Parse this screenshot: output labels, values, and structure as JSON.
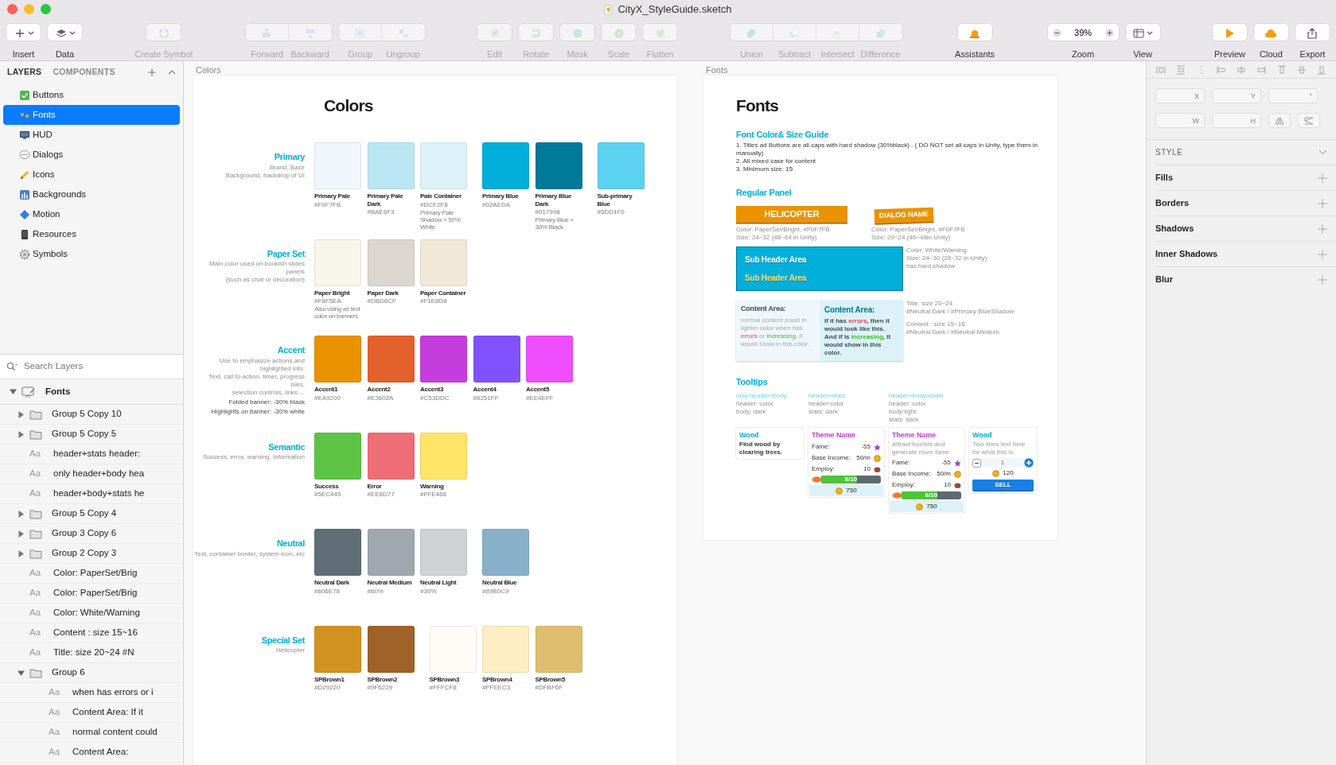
{
  "window": {
    "title": "CityX_StyleGuide.sketch"
  },
  "toolbar": {
    "sections": [
      [
        [
          {
            "label": "Insert",
            "kind": "dropdown",
            "disabled": false
          }
        ],
        [
          {
            "label": "Data",
            "kind": "dropdown",
            "disabled": false
          }
        ]
      ],
      [
        [
          {
            "label": "Create Symbol",
            "kind": "plain",
            "disabled": true
          }
        ]
      ],
      [
        [
          {
            "label": "Forward",
            "kind": "plain",
            "disabled": true
          },
          {
            "label": "Backward",
            "kind": "plain",
            "disabled": true
          }
        ],
        [
          {
            "label": "Group",
            "kind": "plain",
            "disabled": true
          },
          {
            "label": "Ungroup",
            "kind": "plain",
            "disabled": true
          }
        ]
      ],
      [
        [
          {
            "label": "Edit",
            "kind": "plain",
            "disabled": true
          }
        ],
        [
          {
            "label": "Rotate",
            "kind": "plain",
            "disabled": true
          }
        ],
        [
          {
            "label": "Mask",
            "kind": "plain",
            "disabled": true
          }
        ],
        [
          {
            "label": "Scale",
            "kind": "plain",
            "disabled": true
          }
        ],
        [
          {
            "label": "Flatten",
            "kind": "plain",
            "disabled": true
          }
        ]
      ],
      [
        [
          {
            "label": "Union",
            "kind": "plain",
            "disabled": true
          },
          {
            "label": "Subtract",
            "kind": "plain",
            "disabled": true
          },
          {
            "label": "Intersect",
            "kind": "plain",
            "disabled": true
          },
          {
            "label": "Difference",
            "kind": "plain",
            "disabled": true
          }
        ]
      ],
      [
        [
          {
            "label": "Assistants",
            "kind": "plain",
            "disabled": false
          }
        ]
      ],
      [
        [
          {
            "label": "Zoom",
            "kind": "zoom",
            "value": "39%",
            "disabled": false
          }
        ],
        [
          {
            "label": "View",
            "kind": "dropdown",
            "disabled": false
          }
        ]
      ],
      [
        [
          {
            "label": "Preview",
            "kind": "plain",
            "disabled": false
          }
        ],
        [
          {
            "label": "Cloud",
            "kind": "plain",
            "disabled": false
          }
        ],
        [
          {
            "label": "Export",
            "kind": "plain",
            "disabled": false
          }
        ]
      ]
    ]
  },
  "sidebar": {
    "tabs": [
      {
        "label": "LAYERS",
        "selected": true
      },
      {
        "label": "COMPONENTS",
        "selected": false
      }
    ],
    "pages": [
      {
        "label": "Buttons",
        "selected": false
      },
      {
        "label": "Fonts",
        "selected": true
      },
      {
        "label": "HUD",
        "selected": false
      },
      {
        "label": "Dialogs",
        "selected": false
      },
      {
        "label": "Icons",
        "selected": false
      },
      {
        "label": "Backgrounds",
        "selected": false
      },
      {
        "label": "Motion",
        "selected": false
      },
      {
        "label": "Resources",
        "selected": false
      },
      {
        "label": "Symbols",
        "selected": false
      }
    ],
    "search": {
      "placeholder": "Search Layers"
    },
    "layers": [
      {
        "label": "Fonts",
        "kind": "artboard",
        "expanded": true,
        "children": [
          {
            "label": "Group 5 Copy 10",
            "kind": "group",
            "expanded": false
          },
          {
            "label": "Group 5 Copy 5",
            "kind": "group",
            "expanded": false
          },
          {
            "label": "header+stats header:",
            "kind": "text",
            "glyph": "Aa"
          },
          {
            "label": "only header+body hea",
            "kind": "text",
            "glyph": "Aa"
          },
          {
            "label": "header+body+stats he",
            "kind": "text",
            "glyph": "Aa"
          },
          {
            "label": "Group 5 Copy 4",
            "kind": "group",
            "expanded": false
          },
          {
            "label": "Group 3 Copy 6",
            "kind": "group",
            "expanded": false
          },
          {
            "label": "Group 2 Copy 3",
            "kind": "group",
            "expanded": false
          },
          {
            "label": "Color: PaperSet/Brig",
            "kind": "text",
            "glyph": "Aa"
          },
          {
            "label": "Color: PaperSet/Brig",
            "kind": "text",
            "glyph": "Aa"
          },
          {
            "label": "Color: White/Warning",
            "kind": "text",
            "glyph": "Aa"
          },
          {
            "label": "Content : size 15~16",
            "kind": "text",
            "glyph": "Aa"
          },
          {
            "label": "Title: size 20~24 #N",
            "kind": "text",
            "glyph": "Aa"
          },
          {
            "label": "Group 6",
            "kind": "group",
            "expanded": true,
            "children": [
              {
                "label": "when has errors or i",
                "kind": "text",
                "glyph": "Aa"
              },
              {
                "label": "Content Area: If it",
                "kind": "text",
                "glyph": "Aa"
              },
              {
                "label": "normal content could",
                "kind": "text",
                "glyph": "Aa"
              },
              {
                "label": "Content Area:",
                "kind": "text",
                "glyph": "Aa"
              }
            ]
          }
        ]
      }
    ]
  },
  "colors_board": {
    "label": "Colors",
    "title": "Colors",
    "sections": [
      {
        "title": "Primary",
        "lines": [
          "Brand, Base",
          "Background, backdrop of UI"
        ],
        "groups": [
          [
            {
              "name": "Primary Pale",
              "hex": "#F0F7FB",
              "color": "#f0f7fb"
            },
            {
              "name": "Primary Pale Dark",
              "hex": "#BAE6F3",
              "color": "#bae6f3"
            },
            {
              "name": "Pale Container",
              "hex": "#DCF2F8",
              "note": "Primary Pale Shadow + 50% White",
              "color": "#dcf2f8"
            }
          ],
          [
            {
              "name": "Primary Blue",
              "hex": "#02AEDA",
              "color": "#02aeda"
            },
            {
              "name": "Primary Blue Dark",
              "hex": "#017998",
              "note": "Primary Blue + 30% Black",
              "color": "#017998"
            }
          ],
          [
            {
              "name": "Sub-primary Blue",
              "hex": "#5DD1F0",
              "color": "#5dd1f0"
            }
          ]
        ]
      },
      {
        "title": "Paper Set",
        "lines": [
          "Main color used on bookish slides panels",
          "(such as chat or decoration)"
        ],
        "groups": [
          [
            {
              "name": "Paper Bright",
              "hex": "#F8F5EA",
              "note": "Also using as text color on banners",
              "color": "#f8f5ea"
            },
            {
              "name": "Paper Dark",
              "hex": "#DBD6CF",
              "color": "#dbd6cf"
            },
            {
              "name": "Paper Container",
              "hex": "#F1E8D8",
              "color": "#f1e8d8"
            }
          ]
        ]
      },
      {
        "title": "Accent",
        "lines": [
          "Use to emphasize actions and highlighted info:",
          "Text, call to action,  timer, progress bars,",
          "selection controls, links...."
        ],
        "notes": [
          "Folded banner: -30% black",
          "Highlights on banner: -30% white"
        ],
        "groups": [
          [
            {
              "name": "Accent1",
              "hex": "#EA9200",
              "color": "#ea9200"
            },
            {
              "name": "Accent2",
              "hex": "#E3602A",
              "color": "#e3602a"
            },
            {
              "name": "Accent3",
              "hex": "#C53DDC",
              "color": "#c53ddc"
            },
            {
              "name": "Accent4",
              "hex": "#8251FF",
              "color": "#8251ff"
            },
            {
              "name": "Accent5",
              "hex": "#EE4EFF",
              "color": "#ee4eff"
            }
          ]
        ]
      },
      {
        "title": "Semantic",
        "lines": [
          "Success, error, warning, Information"
        ],
        "groups": [
          [
            {
              "name": "Success",
              "hex": "#5EC445",
              "color": "#5ec445"
            },
            {
              "name": "Error",
              "hex": "#EE6D77",
              "color": "#ee6d77"
            },
            {
              "name": "Warning",
              "hex": "#FFE468",
              "color": "#ffe468"
            }
          ]
        ]
      },
      {
        "title": "Neutral",
        "lines": [
          "Text, container border, system icon, etc"
        ],
        "groups": [
          [
            {
              "name": "Neutral Dark",
              "hex": "#606E78",
              "color": "#606e78"
            },
            {
              "name": "Neutral Medium",
              "hex": "#60%",
              "color": "#a0a7ae"
            },
            {
              "name": "Neutral Light",
              "hex": "#30%",
              "color": "#d0d3d6"
            }
          ],
          [
            {
              "name": "Neutral Blue",
              "hex": "#89B0C9",
              "color": "#89b0c9"
            }
          ]
        ]
      },
      {
        "title": "Special Set",
        "lines": [
          "Helicopter"
        ],
        "groups": [
          [
            {
              "name": "SPBrown1",
              "hex": "#D29220",
              "color": "#d29220"
            },
            {
              "name": "SPBrown2",
              "hex": "#9F6229",
              "color": "#9f6229"
            }
          ],
          [
            {
              "name": "SPBrown3",
              "hex": "#FFFCF8",
              "color": "#fffcf8"
            },
            {
              "name": "SPBrown4",
              "hex": "#FFEEC3",
              "color": "#ffeec3"
            },
            {
              "name": "SPBrown5",
              "hex": "#DFBF6F",
              "color": "#dfbf6f"
            }
          ]
        ]
      }
    ]
  },
  "fonts_board": {
    "label": "Fonts",
    "title": "Fonts",
    "guide": {
      "title": "Font Color& Size Guide",
      "lines": [
        "1. Titles ad Buttons are all caps with hard shadow (30%black) .  ( DO NOT set all caps in Unity, type them in manually)",
        "2. All mixed case for content",
        "3. Minimum size: 15"
      ]
    },
    "panel": {
      "title": "Regular Panel",
      "banners": [
        {
          "text": "HELICOPTER",
          "kind": "flat",
          "lines": [
            "Color: PaperSet/Bright, #F0F7FB",
            "Size: 24~32 (48~64 in Unity)"
          ]
        },
        {
          "text": "DIALOG NAME",
          "kind": "tilted",
          "lines": [
            "Color: PaperSet/Bright, #F0F7FB",
            "Size: 20~24 (40~48in Unity)"
          ]
        }
      ],
      "subheaders": [
        {
          "text": "Sub Header Area",
          "kind": "white"
        },
        {
          "text": "Sub Header Area",
          "kind": "warning"
        }
      ],
      "subheader_notes": [
        "Color: White/Warning",
        "Size: 24~30  (28~32 in Unity)",
        "has hard shadow"
      ],
      "contents": [
        {
          "title": "Content Area:",
          "kind": "pale",
          "segments": [
            {
              "text": "normal content could in lighter color when has ",
              "kind": "plain"
            },
            {
              "text": "errors",
              "kind": "error"
            },
            {
              "text": " or ",
              "kind": "plain"
            },
            {
              "text": "increasing",
              "kind": "increase"
            },
            {
              "text": ", it would show in this color.",
              "kind": "plain"
            }
          ]
        },
        {
          "title": "Content Area:",
          "kind": "container",
          "segments": [
            {
              "text": "If it has ",
              "kind": "plain"
            },
            {
              "text": "errors",
              "kind": "error"
            },
            {
              "text": ",  then it would look like this. And if is ",
              "kind": "plain"
            },
            {
              "text": "increasing",
              "kind": "increase"
            },
            {
              "text": ", it would show in this color.",
              "kind": "plain"
            }
          ]
        }
      ],
      "content_notes": [
        "Title: size 20~24",
        "#Neutral Dark / #Primary BlueShadow",
        "Content : size 15~16",
        "#Neutral Dark / #Neutral Medium"
      ]
    },
    "tooltips": {
      "title": "Tooltips",
      "captions": [
        {
          "title": "only header+body",
          "lines": [
            "header: color",
            "body: dark"
          ]
        },
        {
          "title": "header+stats",
          "lines": [
            "header:color",
            "stats: dark"
          ]
        },
        {
          "title": "header+body+stats",
          "lines": [
            "header: color",
            "body:light",
            "stats: dark"
          ]
        }
      ],
      "cards": [
        {
          "kind": "body",
          "title": "Wood",
          "body": "Find wood by clearing trees."
        },
        {
          "kind": "stats",
          "title": "Theme Name",
          "stats": [
            {
              "label": "Fame:",
              "value": "-55"
            },
            {
              "label": "Base Income:",
              "value": "50/m"
            },
            {
              "label": "Employ:",
              "value": "10"
            }
          ],
          "progress": {
            "level": 0.6,
            "reading": "6/10"
          },
          "footer": "750"
        },
        {
          "kind": "stats",
          "title": "Theme Name",
          "body": "Attract tourists and generate more fame",
          "stats": [
            {
              "label": "Fame:",
              "value": "-55"
            },
            {
              "label": "Base Income:",
              "value": "50/m"
            },
            {
              "label": "Employ:",
              "value": "10"
            }
          ],
          "progress": {
            "level": 0.6,
            "reading": "6/10"
          },
          "footer": "750"
        },
        {
          "kind": "sell",
          "title": "Wood",
          "body": "Two lines text here for what this is.",
          "quantity": "1",
          "price": "120",
          "button": "SELL"
        }
      ]
    }
  },
  "inspector": {
    "fields": [
      {
        "label": "X"
      },
      {
        "label": "Y"
      },
      {
        "label": "°"
      },
      {
        "label": "W"
      },
      {
        "label": "H"
      }
    ],
    "style": {
      "title": "STYLE",
      "expanded": true,
      "sections": [
        "Fills",
        "Borders",
        "Shadows",
        "Inner Shadows",
        "Blur"
      ]
    }
  }
}
